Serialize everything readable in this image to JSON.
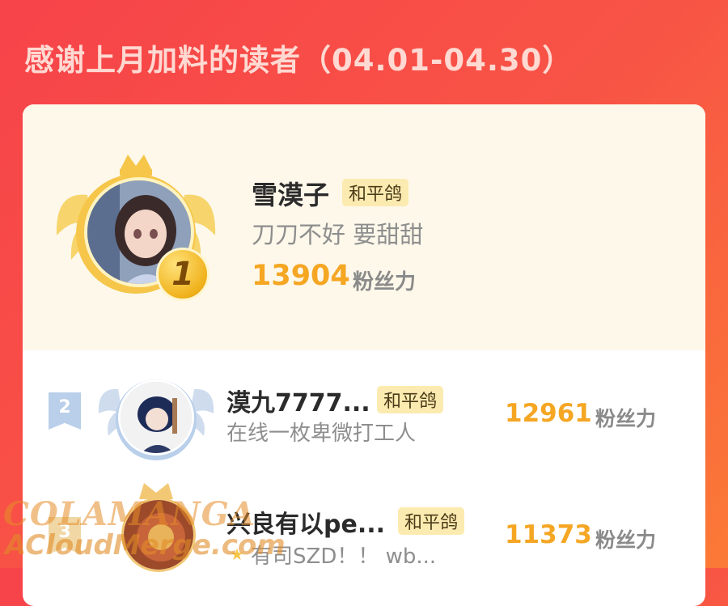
{
  "header": {
    "title": "感谢上月加料的读者（04.01-04.30）"
  },
  "leaderboard": [
    {
      "rank": "1",
      "name": "雪漠子",
      "badge": "和平鸽",
      "subtitle": "刀刀不好 要甜甜",
      "score": "13904",
      "unit": "粉丝力"
    },
    {
      "rank": "2",
      "name": "漠九7777...",
      "badge": "和平鸽",
      "subtitle": "在线一枚卑微打工人",
      "score": "12961",
      "unit": "粉丝力"
    },
    {
      "rank": "3",
      "name": "兴良有以pe...",
      "badge": "和平鸽",
      "subtitle": "有司SZD！！ wb...",
      "score": "11373",
      "unit": "粉丝力"
    }
  ],
  "watermark": {
    "line1": "COLAMANGA",
    "line2": "ACloudMerge.com"
  },
  "colors": {
    "accent": "#f5a623",
    "header_bg": "#f7434a",
    "badge_bg": "#fcebb0"
  }
}
